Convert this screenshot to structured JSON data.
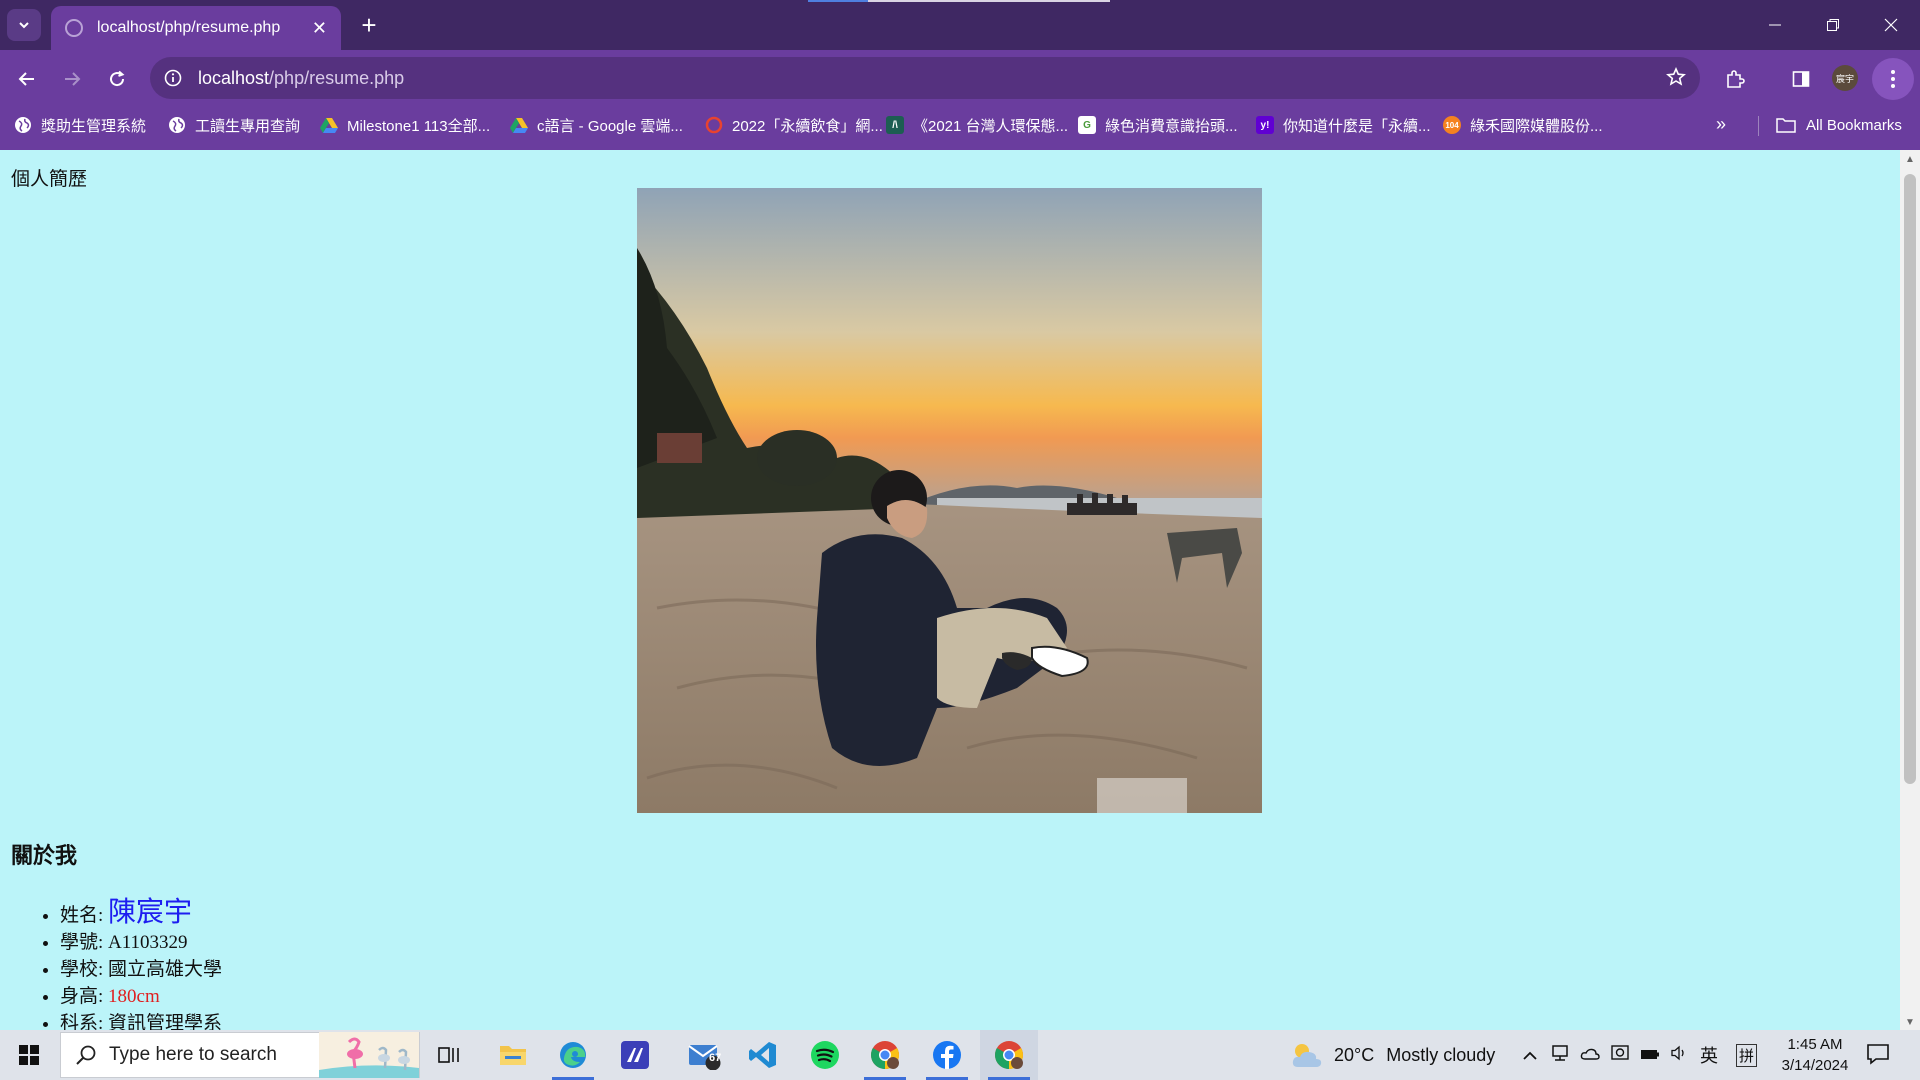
{
  "browser": {
    "tab_title": "localhost/php/resume.php",
    "url_host": "localhost",
    "url_path": "/php/resume.php",
    "profile_initials": "宸宇",
    "all_bookmarks": "All Bookmarks"
  },
  "bookmarks": [
    {
      "label": "獎助生管理系統",
      "icon": "globe-icon"
    },
    {
      "label": "工讀生專用查詢",
      "icon": "globe-icon"
    },
    {
      "label": "Milestone1 113全部...",
      "icon": "google-drive-icon"
    },
    {
      "label": "c語言 - Google 雲端...",
      "icon": "google-drive-icon"
    },
    {
      "label": "2022「永續飲食」網...",
      "icon": "circle-logo-icon"
    },
    {
      "label": "《2021 台灣人環保態...",
      "icon": "survey-logo-icon"
    },
    {
      "label": "綠色消費意識抬頭...",
      "icon": "site-logo-icon"
    },
    {
      "label": "你知道什麼是「永續...",
      "icon": "yahoo-icon"
    },
    {
      "label": "綠禾國際媒體股份...",
      "icon": "logo-104-icon"
    }
  ],
  "page": {
    "heading": "個人簡歷",
    "about_title": "關於我",
    "info": {
      "name_label": "姓名: ",
      "name_value": "陳宸宇",
      "student_id_label": "學號: ",
      "student_id_value": "A1103329",
      "school_label": "學校: ",
      "school_value": "國立高雄大學",
      "height_label": "身高: ",
      "height_value": "180cm",
      "dept_label": "科系: ",
      "dept_value": "資訊管理學系"
    }
  },
  "taskbar": {
    "search_placeholder": "Type here to search",
    "mail_badge": "67",
    "weather_temp": "20°C",
    "weather_desc": "Mostly cloudy",
    "ime_lang": "英",
    "ime_mode": "拼",
    "time": "1:45 AM",
    "date": "3/14/2024"
  },
  "colors": {
    "page_background": "#bbf4f9",
    "browser_frame": "#6a3d9e",
    "name_color": "#1d1df0",
    "height_color": "#e01f1f"
  }
}
